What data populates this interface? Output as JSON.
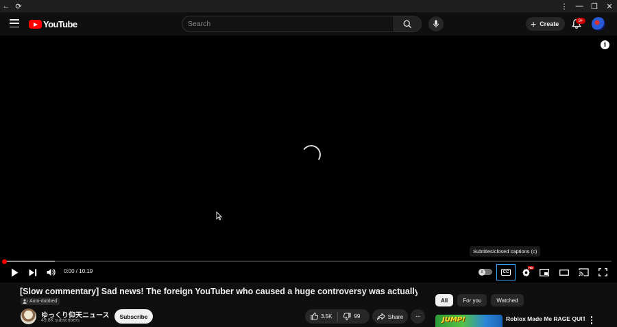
{
  "browser": {
    "back_icon": "←",
    "reload_icon": "⟳",
    "menu_icon": "⋮",
    "minimize_icon": "—",
    "restore_icon": "❐",
    "close_icon": "✕"
  },
  "header": {
    "logo_text": "YouTube",
    "search_placeholder": "Search",
    "create_label": "Create",
    "notification_count": "9+"
  },
  "player": {
    "info_icon": "i",
    "tooltip": "Subtitles/closed captions (c)",
    "time_display": "0:00 / 10:19",
    "progress_played": 0.0,
    "progress_buffered": 0.083,
    "cc_label": "CC",
    "hd_badge": "HD",
    "autoplay_icon": "II"
  },
  "video": {
    "title": "[Slow commentary] Sad news! The foreign YouTuber who caused a huge controversy was actually sanct...",
    "auto_dubbed_label": "Auto-dubbed",
    "channel_name": "ゆっくり仰天ニュース",
    "subscribers": "49.8K subscribers",
    "subscribe_label": "Subscribe",
    "likes": "3.5K",
    "dislikes": "99",
    "share_label": "Share",
    "more_label": "···"
  },
  "sidebar": {
    "chips": [
      {
        "label": "All",
        "active": true
      },
      {
        "label": "For you",
        "active": false
      },
      {
        "label": "Watched",
        "active": false
      }
    ],
    "recommendation": {
      "thumb_text": "JUMP!",
      "title": "Roblox Made Me RAGE QUIT..."
    }
  },
  "colors": {
    "accent": "#ff0000",
    "focus": "#3ea6ff",
    "background": "#0f0f0f"
  }
}
